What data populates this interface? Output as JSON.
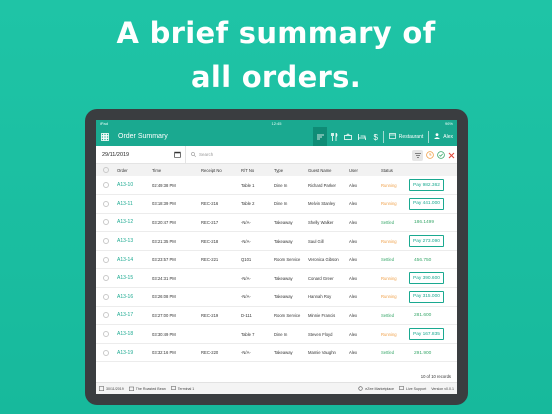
{
  "headline": {
    "line1": "A brief summary of",
    "line2": "all orders."
  },
  "statusbar": {
    "left": "iPad",
    "time": "12:45",
    "right": "96%"
  },
  "appbar": {
    "title": "Order Summary",
    "icons": [
      "list-icon",
      "menu-icon",
      "bag-icon",
      "bed-icon",
      "dollar-icon"
    ],
    "venue": "Restaurant",
    "user": "Alex"
  },
  "filter": {
    "date": "29/11/2019",
    "search_placeholder": "Search"
  },
  "table": {
    "headers": [
      "Order",
      "Time",
      "Receipt No",
      "R/T No",
      "Type",
      "Guest Name",
      "User",
      "Status"
    ],
    "rows": [
      {
        "order": "A13-10",
        "time": "02:49:38 PM",
        "receipt": "",
        "rt": "Table 1",
        "type": "Dine In",
        "guest": "Richard Parker",
        "user": "Alex",
        "status": "Running",
        "action": "Pay 982.362",
        "is_pay": true
      },
      {
        "order": "A13-11",
        "time": "03:18:39 PM",
        "receipt": "REC-216",
        "rt": "Table 2",
        "type": "Dine In",
        "guest": "Melvin Stanley",
        "user": "Alex",
        "status": "Running",
        "action": "Pay 441.000",
        "is_pay": true
      },
      {
        "order": "A13-12",
        "time": "03:20:47 PM",
        "receipt": "REC-217",
        "rt": "-N/A-",
        "type": "Takeaway",
        "guest": "Shelly Walker",
        "user": "Alex",
        "status": "Settled",
        "action": "186.1499",
        "is_pay": false
      },
      {
        "order": "A13-13",
        "time": "03:21:35 PM",
        "receipt": "REC-218",
        "rt": "-N/A-",
        "type": "Takeaway",
        "guest": "Saul Gill",
        "user": "Alex",
        "status": "Running",
        "action": "Pay 273.090",
        "is_pay": true
      },
      {
        "order": "A13-14",
        "time": "03:23:57 PM",
        "receipt": "REC-221",
        "rt": "Q101",
        "type": "Room Service",
        "guest": "Veronica Gibson",
        "user": "Alex",
        "status": "Settled",
        "action": "456.750",
        "is_pay": false
      },
      {
        "order": "A13-15",
        "time": "03:24:31 PM",
        "receipt": "",
        "rt": "-N/A-",
        "type": "Takeaway",
        "guest": "Conard Greer",
        "user": "Alex",
        "status": "Running",
        "action": "Pay 390.600",
        "is_pay": true
      },
      {
        "order": "A13-16",
        "time": "03:26:08 PM",
        "receipt": "",
        "rt": "-N/A-",
        "type": "Takeaway",
        "guest": "Hannah Roy",
        "user": "Alex",
        "status": "Running",
        "action": "Pay 315.000",
        "is_pay": true
      },
      {
        "order": "A13-17",
        "time": "03:27:00 PM",
        "receipt": "REC-219",
        "rt": "D-111",
        "type": "Room Service",
        "guest": "Minnie Francis",
        "user": "Alex",
        "status": "Settled",
        "action": "281.600",
        "is_pay": false
      },
      {
        "order": "A13-18",
        "time": "03:30:49 PM",
        "receipt": "",
        "rt": "Table 7",
        "type": "Dine In",
        "guest": "Steven Floyd",
        "user": "Alex",
        "status": "Running",
        "action": "Pay 167.835",
        "is_pay": true
      },
      {
        "order": "A13-19",
        "time": "03:32:16 PM",
        "receipt": "REC-220",
        "rt": "-N/A-",
        "type": "Takeaway",
        "guest": "Mamie Vaughn",
        "user": "Alex",
        "status": "Settled",
        "action": "291.900",
        "is_pay": false
      }
    ]
  },
  "record_count": "10 of 10 records",
  "footer": {
    "date": "30/11/2019",
    "store": "The Roasted Bean",
    "terminal": "Terminal 1",
    "marketplace": "eZee Marketplace",
    "support": "Live Support",
    "version": "Version v0.0.1"
  },
  "colors": {
    "brand": "#1aa990",
    "background": "#1fc4a6",
    "running": "#f0a14a",
    "settled": "#3aa86b"
  }
}
